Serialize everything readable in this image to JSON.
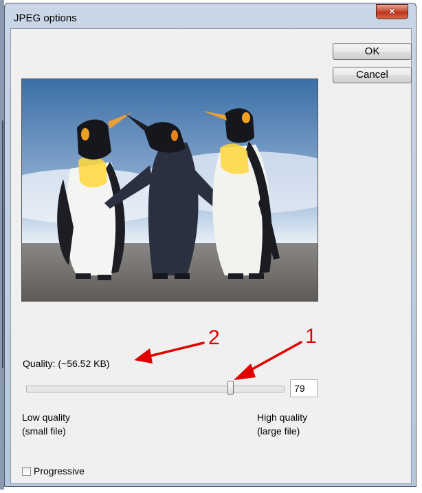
{
  "window": {
    "title": "JPEG options",
    "close_glyph": "×"
  },
  "buttons": {
    "ok": "OK",
    "cancel": "Cancel"
  },
  "preview": {
    "alt": "penguins photo preview"
  },
  "quality": {
    "label": "Quality: (~56.52 KB)",
    "value": "79",
    "slider_min": 0,
    "slider_max": 100,
    "slider_value": 79,
    "low_line1": "Low quality",
    "low_line2": "(small file)",
    "high_line1": "High quality",
    "high_line2": "(large file)"
  },
  "progressive": {
    "label": "Progressive",
    "checked": false
  },
  "annotations": {
    "arrow1": "1",
    "arrow2": "2",
    "color": "#e00000"
  }
}
